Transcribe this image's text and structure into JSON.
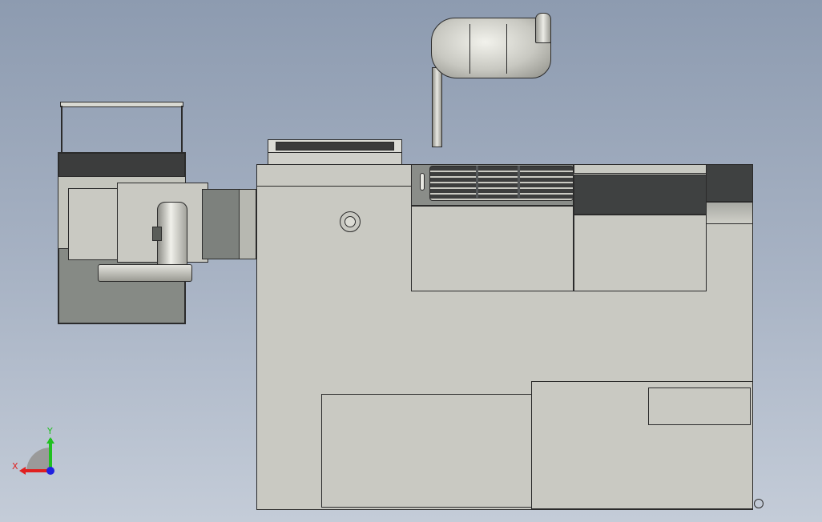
{
  "view": {
    "background_top": "#8d9bb0",
    "background_bottom": "#c4ccd8",
    "model_color": "#c9c9c2",
    "edge_color": "#2b2b2b"
  },
  "triad": {
    "x_label": "X",
    "y_label": "Y",
    "x_color": "#e02020",
    "y_color": "#20c020",
    "z_color": "#2020e0"
  }
}
